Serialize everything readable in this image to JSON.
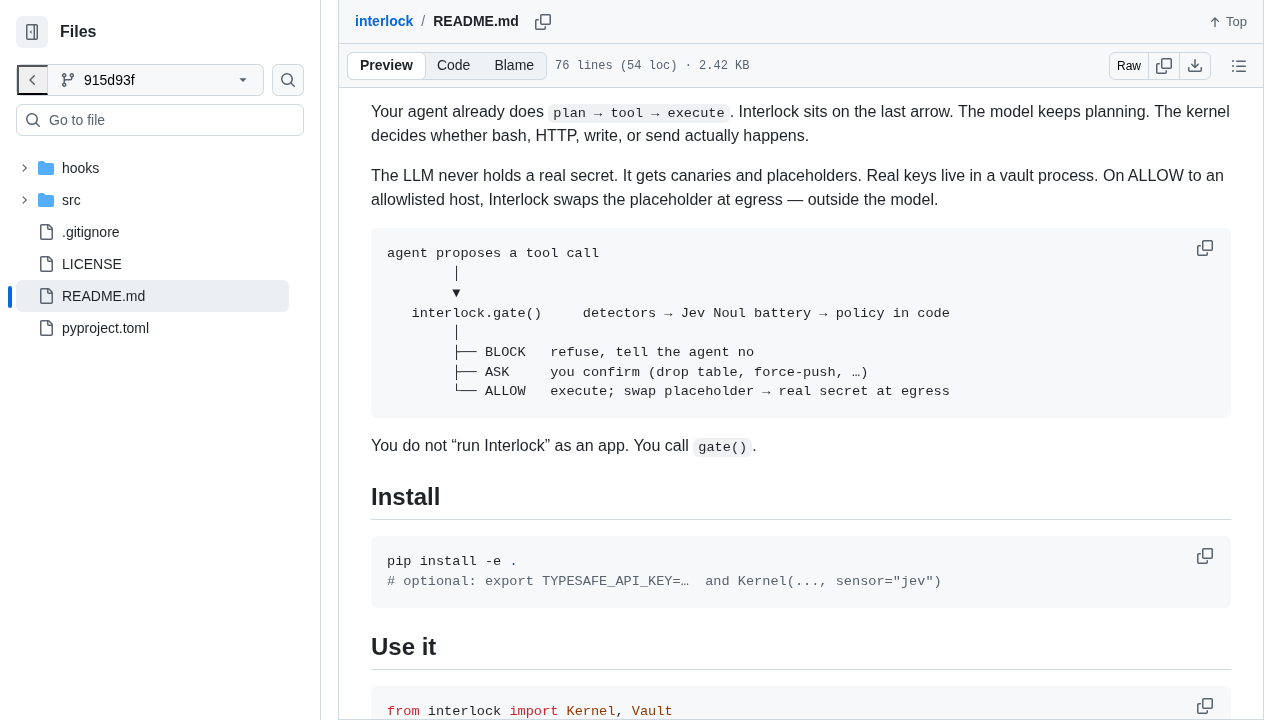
{
  "sidebar": {
    "title": "Files",
    "branch": "915d93f",
    "search": {
      "placeholder": "Go to file"
    },
    "tree": [
      {
        "kind": "folder",
        "label": "hooks",
        "expanded": false,
        "selected": false
      },
      {
        "kind": "folder",
        "label": "src",
        "expanded": false,
        "selected": false
      },
      {
        "kind": "file",
        "label": ".gitignore",
        "selected": false
      },
      {
        "kind": "file",
        "label": "LICENSE",
        "selected": false
      },
      {
        "kind": "file",
        "label": "README.md",
        "selected": true
      },
      {
        "kind": "file",
        "label": "pyproject.toml",
        "selected": false
      }
    ]
  },
  "header": {
    "repo": "interlock",
    "separator": "/",
    "file": "README.md",
    "top": "Top"
  },
  "toolbar": {
    "tabs": [
      {
        "label": "Preview",
        "selected": true
      },
      {
        "label": "Code",
        "selected": false
      },
      {
        "label": "Blame",
        "selected": false
      }
    ],
    "info": "76 lines (54 loc) · 2.42 KB",
    "raw": "Raw"
  },
  "content": [
    {
      "kind": "paragraph",
      "segments": [
        {
          "kind": "text",
          "text": "Your agent already does "
        },
        {
          "kind": "code",
          "text": "plan → tool → execute"
        },
        {
          "kind": "text",
          "text": ". Interlock sits on the last arrow. The model keeps planning. The kernel decides whether bash, HTTP, write, or send actually happens."
        }
      ]
    },
    {
      "kind": "paragraph",
      "segments": [
        {
          "kind": "text",
          "text": "The LLM never holds a real secret. It gets canaries and placeholders. Real keys live in a vault process. On ALLOW to an allowlisted host, Interlock swaps the placeholder at egress — outside the model."
        }
      ]
    },
    {
      "kind": "codeblock",
      "lines": [
        [
          {
            "kind": "plain",
            "text": "agent proposes a tool call"
          }
        ],
        [
          {
            "kind": "plain",
            "text": "        │"
          }
        ],
        [
          {
            "kind": "plain",
            "text": "        ▼"
          }
        ],
        [
          {
            "kind": "plain",
            "text": "   interlock.gate()     detectors → Jev Noul battery → policy in code"
          }
        ],
        [
          {
            "kind": "plain",
            "text": "        │"
          }
        ],
        [
          {
            "kind": "plain",
            "text": "        ├── BLOCK   refuse, tell the agent no"
          }
        ],
        [
          {
            "kind": "plain",
            "text": "        ├── ASK     you confirm (drop table, force-push, …)"
          }
        ],
        [
          {
            "kind": "plain",
            "text": "        └── ALLOW   execute; swap placeholder → real secret at egress"
          }
        ]
      ]
    },
    {
      "kind": "paragraph",
      "segments": [
        {
          "kind": "text",
          "text": "You do not “run Interlock” as an app. You call "
        },
        {
          "kind": "code",
          "text": "gate()"
        },
        {
          "kind": "text",
          "text": "."
        }
      ]
    },
    {
      "kind": "heading",
      "text": "Install"
    },
    {
      "kind": "codeblock",
      "lines": [
        [
          {
            "kind": "plain",
            "text": "pip install -e "
          },
          {
            "kind": "constant",
            "text": "."
          }
        ],
        [
          {
            "kind": "comment",
            "text": "# optional: export TYPESAFE_API_KEY=…  and Kernel(..., sensor=\"jev\")"
          }
        ]
      ]
    },
    {
      "kind": "heading",
      "text": "Use it"
    },
    {
      "kind": "codeblock",
      "lines": [
        [
          {
            "kind": "keyword",
            "text": "from"
          },
          {
            "kind": "plain",
            "text": " interlock "
          },
          {
            "kind": "keyword",
            "text": "import "
          },
          {
            "kind": "entity",
            "text": "Kernel"
          },
          {
            "kind": "plain",
            "text": ", "
          },
          {
            "kind": "entity",
            "text": "Vault"
          }
        ]
      ]
    }
  ]
}
